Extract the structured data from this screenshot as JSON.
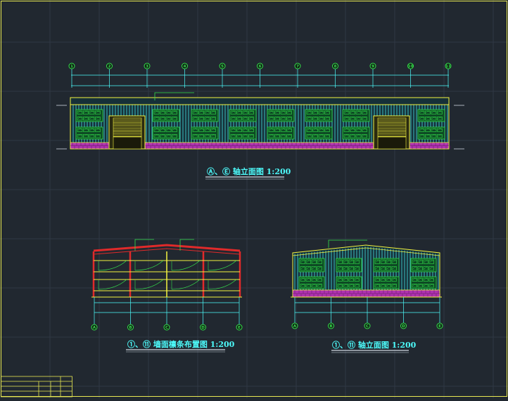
{
  "drawing": {
    "elevation_main": {
      "title": "Ⓐ、Ⓔ 轴立面图 1:200",
      "axis_labels": [
        "1",
        "2",
        "3",
        "4",
        "5",
        "6",
        "7",
        "8",
        "9",
        "10",
        "11"
      ]
    },
    "wall_purlin": {
      "title": "①、⑪ 墙面檩条布置图 1:200",
      "axis_labels": [
        "A",
        "B",
        "C",
        "D",
        "E"
      ]
    },
    "elevation_side": {
      "title": "①、⑪ 轴立面图 1:200",
      "axis_labels": [
        "A",
        "B",
        "C",
        "D",
        "E"
      ]
    }
  },
  "colors": {
    "background": "#212830",
    "frame": "#e8e852",
    "cyan": "#4dfbfb",
    "green": "#35e04a",
    "magenta": "#d23ad2",
    "red": "#e02a2a",
    "yellow": "#f4f441"
  }
}
